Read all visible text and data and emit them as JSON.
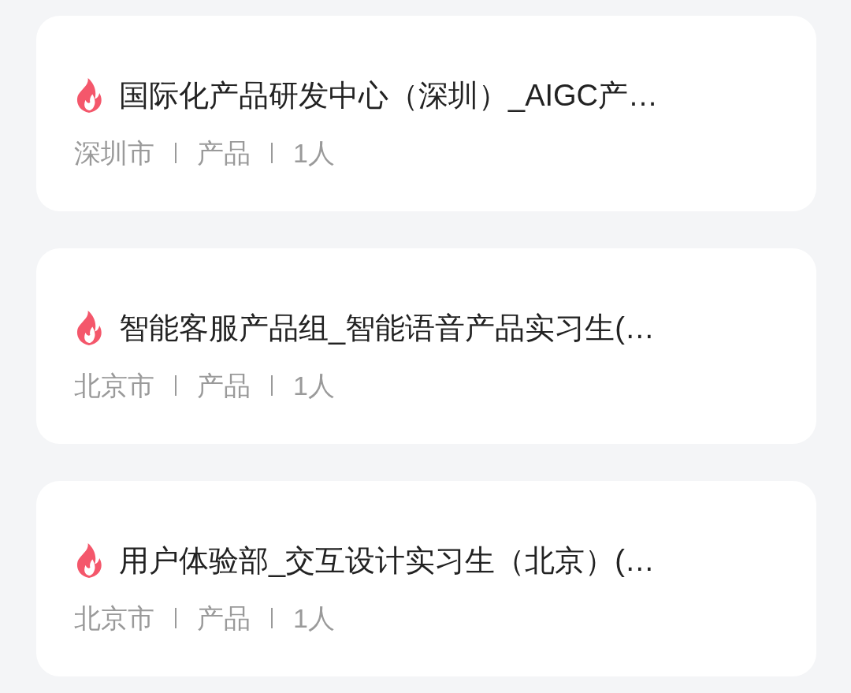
{
  "jobs": [
    {
      "title": "国际化产品研发中心（深圳）_AIGC产…",
      "hot": true,
      "meta": [
        "深圳市",
        "产品",
        "1人"
      ]
    },
    {
      "title": "智能客服产品组_智能语音产品实习生(…",
      "hot": true,
      "meta": [
        "北京市",
        "产品",
        "1人"
      ]
    },
    {
      "title": "用户体验部_交互设计实习生（北京）(…",
      "hot": true,
      "meta": [
        "北京市",
        "产品",
        "1人"
      ]
    }
  ]
}
